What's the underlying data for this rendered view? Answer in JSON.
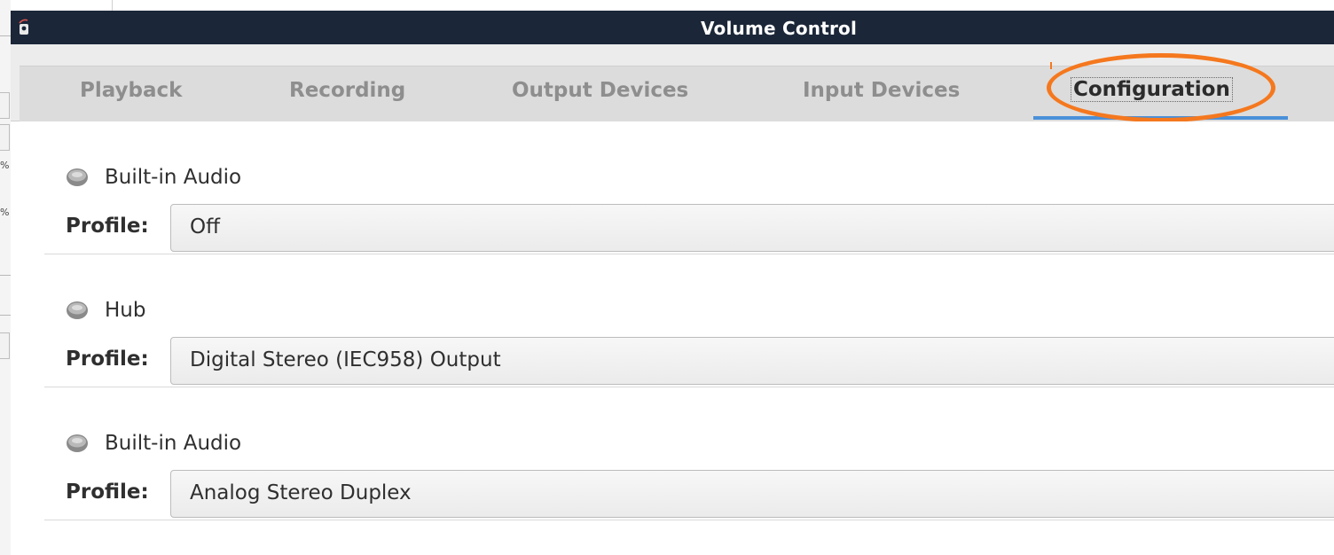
{
  "background_app": {
    "percent_1": "%",
    "percent_2": "%"
  },
  "window": {
    "title": "Volume Control",
    "tabs": [
      {
        "label": "Playback"
      },
      {
        "label": "Recording"
      },
      {
        "label": "Output Devices"
      },
      {
        "label": "Input Devices"
      },
      {
        "label": "Configuration",
        "active": true
      }
    ],
    "annotation_color": "#f5781e",
    "accent_color": "#4a90d9"
  },
  "cards": [
    {
      "icon": "speaker-icon",
      "name": "Built-in Audio",
      "profile_label": "Profile:",
      "profile_value": "Off"
    },
    {
      "icon": "speaker-icon",
      "name": "Hub",
      "profile_label": "Profile:",
      "profile_value": "Digital Stereo (IEC958) Output"
    },
    {
      "icon": "speaker-icon",
      "name": "Built-in Audio",
      "profile_label": "Profile:",
      "profile_value": "Analog Stereo Duplex"
    }
  ]
}
